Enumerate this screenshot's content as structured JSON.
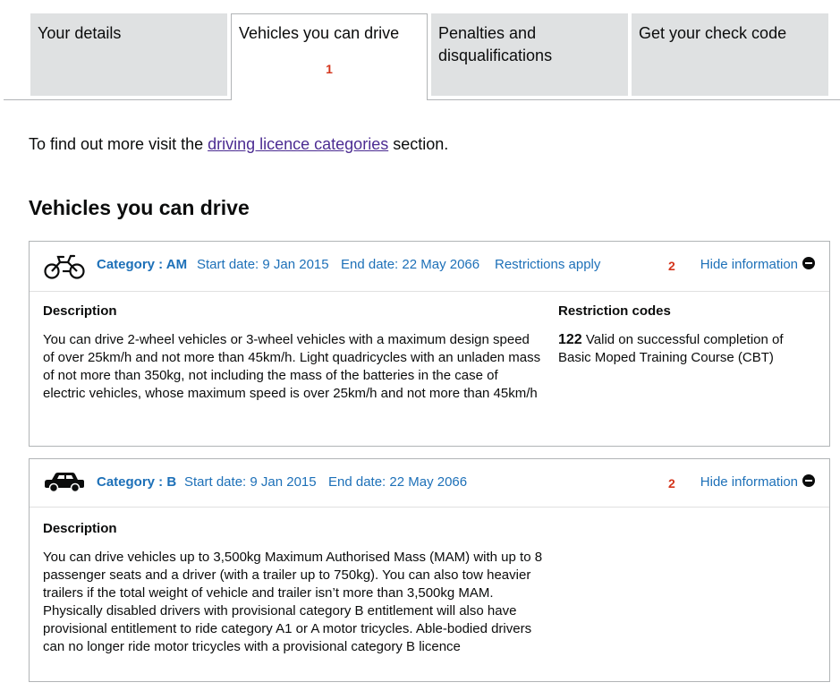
{
  "tabs": [
    {
      "label": "Your details",
      "badge": ""
    },
    {
      "label": "Vehicles you can drive",
      "badge": "1"
    },
    {
      "label": "Penalties and disqualifications",
      "badge": ""
    },
    {
      "label": "Get your check code",
      "badge": ""
    }
  ],
  "intro": {
    "prefix": "To find out more visit the ",
    "link": "driving licence categories",
    "suffix": " section."
  },
  "heading": "Vehicles you can drive",
  "categories": [
    {
      "icon": "moped-icon",
      "category": "Category : AM",
      "start": "Start date: 9 Jan 2015",
      "end": "End date: 22 May 2066",
      "restrictions": "Restrictions apply",
      "badge": "2",
      "hide": "Hide information",
      "description_title": "Description",
      "description": "You can drive 2-wheel vehicles or 3-wheel vehicles with a maximum design speed of over 25km/h and not more than 45km/h. Light quadricycles with an unladen mass of not more than 350kg, not including the mass of the batteries in the case of electric vehicles, whose maximum speed is over 25km/h and not more than 45km/h",
      "restriction_title": "Restriction codes",
      "restriction_code": "122",
      "restriction_text": "Valid on successful completion of Basic Moped Training Course (CBT)"
    },
    {
      "icon": "car-icon",
      "category": "Category : B",
      "start": "Start date: 9 Jan 2015",
      "end": "End date: 22 May 2066",
      "badge": "2",
      "hide": "Hide information",
      "description_title": "Description",
      "description": "You can drive vehicles up to 3,500kg Maximum Authorised Mass (MAM) with up to 8 passenger seats and a driver (with a trailer up to 750kg). You can also tow heavier trailers if the total weight of vehicle and trailer isn’t more than 3,500kg MAM. Physically disabled drivers with provisional category B entitlement will also have provisional entitlement to ride category A1 or A motor tricycles. Able-bodied drivers can no longer ride motor tricycles with a provisional category B licence"
    }
  ]
}
